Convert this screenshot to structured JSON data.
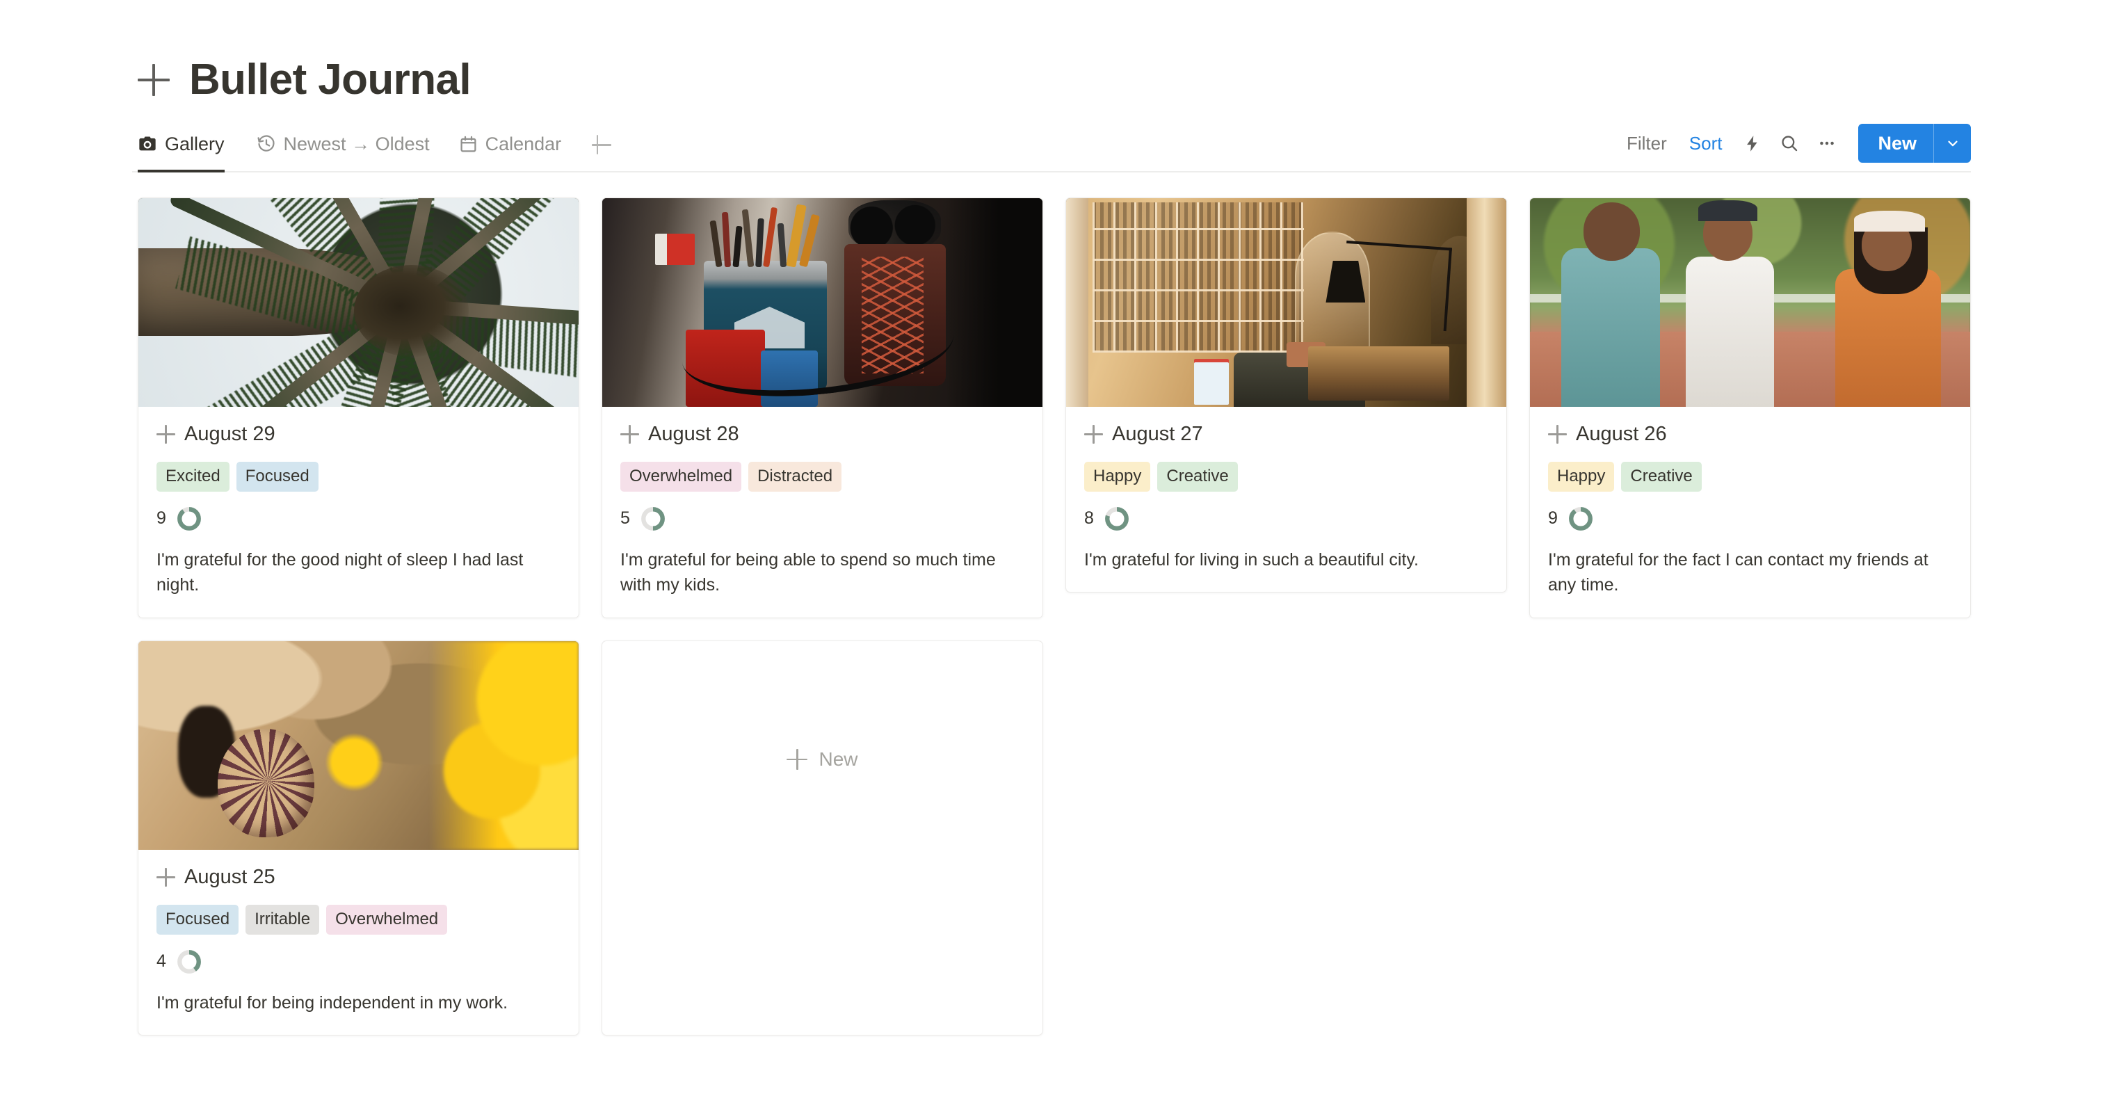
{
  "header": {
    "add_icon": "plus-icon",
    "title": "Bullet Journal"
  },
  "view_tabs": [
    {
      "label": "Gallery",
      "icon": "camera-icon",
      "active": true
    },
    {
      "label": "Newest → Oldest",
      "icon": "history-clock-icon",
      "active": false
    },
    {
      "label": "Calendar",
      "icon": "calendar-icon",
      "active": false
    }
  ],
  "tab_add_icon": "plus-icon",
  "toolbar": {
    "filter_label": "Filter",
    "sort_label": "Sort",
    "automation_icon": "lightning-bolt-icon",
    "search_icon": "search-icon",
    "more_icon": "ellipsis-icon",
    "new_label": "New",
    "new_caret_icon": "chevron-down-icon"
  },
  "colors": {
    "accent_blue": "#2383e2",
    "text_primary": "#37352f",
    "text_muted": "#787774",
    "ring_green": "#6f9382",
    "ring_track": "#e3e2e0",
    "card_border": "#ebeae8",
    "tag_green": "#dbeddb",
    "tag_blue": "#d3e5ef",
    "tag_pink": "#f5e0e9",
    "tag_orange": "#f8e8dc",
    "tag_yellow": "#fbeeca",
    "tag_gray": "#e3e2e0"
  },
  "cards": [
    {
      "title": "August 29",
      "add_icon": "plus-icon",
      "cover": "palm-tree-from-below",
      "tags": [
        {
          "label": "Excited",
          "color": "#dbeddb"
        },
        {
          "label": "Focused",
          "color": "#d3e5ef"
        }
      ],
      "rating": "9",
      "rating_max": 10,
      "note": "I'm grateful for the good night of sleep I had last night."
    },
    {
      "title": "August 28",
      "add_icon": "plus-icon",
      "cover": "desk-workspace-still-life",
      "tags": [
        {
          "label": "Overwhelmed",
          "color": "#f5e0e9"
        },
        {
          "label": "Distracted",
          "color": "#f8e8dc"
        }
      ],
      "rating": "5",
      "rating_max": 10,
      "note": "I'm grateful for being able to spend so much time with my kids."
    },
    {
      "title": "August 27",
      "add_icon": "plus-icon",
      "cover": "bookshop-interior-golden",
      "tags": [
        {
          "label": "Happy",
          "color": "#fbeeca"
        },
        {
          "label": "Creative",
          "color": "#dbeddb"
        }
      ],
      "rating": "8",
      "rating_max": 10,
      "note": "I'm grateful for living in such a beautiful city."
    },
    {
      "title": "August 26",
      "add_icon": "plus-icon",
      "cover": "three-friends-talking-outdoors",
      "tags": [
        {
          "label": "Happy",
          "color": "#fbeeca"
        },
        {
          "label": "Creative",
          "color": "#dbeddb"
        }
      ],
      "rating": "9",
      "rating_max": 10,
      "note": "I'm grateful for the fact I can contact my friends at any time."
    },
    {
      "title": "August 25",
      "add_icon": "plus-icon",
      "cover": "snail-on-rock-yellow-lichen",
      "tags": [
        {
          "label": "Focused",
          "color": "#d3e5ef"
        },
        {
          "label": "Irritable",
          "color": "#e3e2e0"
        },
        {
          "label": "Overwhelmed",
          "color": "#f5e0e9"
        }
      ],
      "rating": "4",
      "rating_max": 10,
      "note": "I'm grateful for being independent in my work."
    }
  ],
  "new_card": {
    "label": "New",
    "icon": "plus-icon"
  }
}
